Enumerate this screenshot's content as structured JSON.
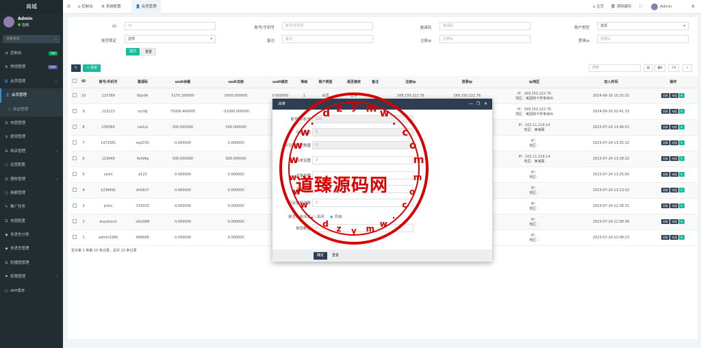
{
  "brand": "商城",
  "user": {
    "name": "Admin",
    "status": "在线"
  },
  "search": {
    "placeholder": "搜索菜单"
  },
  "menu": [
    {
      "label": "控制台",
      "icon": "dashboard-icon",
      "tag": "hot",
      "tag_color": "#00a65a"
    },
    {
      "label": "常规管理",
      "icon": "cogs-icon",
      "tag": "new",
      "tag_color": "#605ca8"
    },
    {
      "label": "会员管理",
      "icon": "user-icon",
      "active": true
    },
    {
      "label": "会员管理",
      "icon": "user-icon",
      "current": true
    },
    {
      "label": "收益管理",
      "icon": "circle-icon",
      "sub": true
    },
    {
      "label": "充值管理",
      "icon": "bars-icon"
    },
    {
      "label": "提现管理",
      "icon": "dollar-icon"
    },
    {
      "label": "商店管理",
      "icon": "bars-icon",
      "caret": true
    },
    {
      "label": "运营配置",
      "icon": "circle-icon"
    },
    {
      "label": "理财管理",
      "icon": "bars-icon",
      "caret": true
    },
    {
      "label": "卷额管理",
      "icon": "circle-icon"
    },
    {
      "label": "推广任务",
      "icon": "wrench-icon"
    },
    {
      "label": "充值配置",
      "icon": "bars-icon"
    },
    {
      "label": "多语言分类",
      "icon": "tag-icon"
    },
    {
      "label": "多语言管理",
      "icon": "tag-icon"
    },
    {
      "label": "轮播图管理",
      "icon": "bars-icon"
    },
    {
      "label": "权限管理",
      "icon": "group-icon",
      "caret": true
    },
    {
      "label": "APP版本",
      "icon": "circle-icon"
    }
  ],
  "topbar": {
    "tabs": [
      "控制台",
      "系统配置",
      "会员管理"
    ],
    "home": "主页",
    "clear": "清除缓存",
    "admin": "Admin"
  },
  "filters": {
    "id_label": "ID",
    "id_ph": "ID",
    "account_label": "账号/手机号",
    "account_ph": "账号/手机号",
    "invite_label": "邀请码",
    "invite_ph": "邀请码",
    "acct_type_label": "账户类型",
    "acct_type_value": "选择",
    "locked_label": "是否锁定",
    "locked_value": "选择",
    "remark_label": "备注",
    "remark_ph": "备注",
    "regip_label": "注册ip",
    "regip_ph": "注册ip",
    "loginip_label": "登录ip",
    "loginip_ph": "登录ip",
    "submit": "提交",
    "reset": "重置"
  },
  "toolbar": {
    "add": "+ 添加",
    "search_ph": "搜索"
  },
  "table": {
    "headers": [
      "ID",
      "账号/手机号",
      "邀请码",
      "usdt余额",
      "usdt冻结",
      "usdt锁定",
      "等级",
      "账户类型",
      "是否锁定",
      "备注",
      "注册ip",
      "登录ip",
      "ip地区",
      "加入时间",
      "操作"
    ],
    "rows": [
      {
        "id": "10",
        "account": "123789",
        "invite": "6tpr9k",
        "balance": "5170.160000",
        "frozen": "5000.000000",
        "locked": "0.000000",
        "level": "1",
        "type": "会员",
        "lock": "正常",
        "remark": "-",
        "regip": "169.150.222.76",
        "loginip": "169.150.222.76",
        "region1": "IP：169.150.222.76",
        "region2": "地区：美国南卡罗来纳州",
        "time": "2024-08-16 10:25:25"
      },
      {
        "id": "9",
        "account": "123123",
        "invite": "sccfdj",
        "balance": "75006.440000",
        "frozen": "-51000.000000",
        "locked": "",
        "level": "",
        "type": "",
        "lock": "",
        "remark": "",
        "regip": "",
        "loginip": "",
        "region1": "IP：169.150.222.76",
        "region2": "地区：美国南卡罗来纳州",
        "time": "2024-08-16 02:41:33"
      },
      {
        "id": "8",
        "account": "258369",
        "invite": "vle1pi",
        "balance": "500.000000",
        "frozen": "500.000000",
        "locked": "",
        "level": "",
        "type": "",
        "lock": "",
        "remark": "",
        "regip": "",
        "loginip": "14",
        "region1": "IP：103.11.219.14",
        "region2": "地区：柬埔寨",
        "time": "2023-07-24 13:46:52"
      },
      {
        "id": "7",
        "account": "1472581",
        "invite": "eq2CfQ",
        "balance": "0.000000",
        "frozen": "0.000000",
        "locked": "",
        "level": "",
        "type": "",
        "lock": "",
        "remark": "",
        "regip": "",
        "loginip": "",
        "region1": "IP：",
        "region2": "地区：",
        "time": "2023-07-24 13:35:32"
      },
      {
        "id": "6",
        "account": "123649",
        "invite": "4xfd4g",
        "balance": "500.000000",
        "frozen": "500.000000",
        "locked": "",
        "level": "",
        "type": "",
        "lock": "",
        "remark": "",
        "regip": "",
        "loginip": "14",
        "region1": "IP：103.11.219.14",
        "region2": "地区：柬埔寨",
        "time": "2023-07-24 13:28:32"
      },
      {
        "id": "5",
        "account": "ceshi",
        "invite": "a123",
        "balance": "0.000000",
        "frozen": "0.000000",
        "locked": "",
        "level": "",
        "type": "",
        "lock": "",
        "remark": "",
        "regip": "",
        "loginip": "",
        "region1": "IP：",
        "region2": "地区：",
        "time": "2023-07-24 13:25:00"
      },
      {
        "id": "4",
        "account": "1236491",
        "invite": "ArOXcT",
        "balance": "0.000000",
        "frozen": "0.000000",
        "locked": "",
        "level": "",
        "type": "",
        "lock": "",
        "remark": "",
        "regip": "",
        "loginip": "",
        "region1": "IP：",
        "region2": "地区：",
        "time": "2023-07-24 13:13:32"
      },
      {
        "id": "3",
        "account": "jmhu",
        "invite": "333333",
        "balance": "0.000000",
        "frozen": "0.000000",
        "locked": "",
        "level": "",
        "type": "",
        "lock": "",
        "remark": "",
        "regip": "",
        "loginip": "",
        "region1": "IP：",
        "region2": "地区：",
        "time": "2023-07-24 12:28:31"
      },
      {
        "id": "2",
        "account": "wuyanzu1",
        "invite": "sGxQ6R",
        "balance": "0.000000",
        "frozen": "0.000000",
        "locked": "",
        "level": "",
        "type": "",
        "lock": "",
        "remark": "",
        "regip": "",
        "loginip": "14",
        "region1": "IP：",
        "region2": "地区：",
        "time": "2023-07-24 12:08:38"
      },
      {
        "id": "1",
        "account": "admin3366",
        "invite": "666666",
        "balance": "0.000000",
        "frozen": "0.000000",
        "locked": "",
        "level": "",
        "type": "",
        "lock": "",
        "remark": "",
        "regip": "",
        "loginip": "",
        "region1": "IP：",
        "region2": "地区：",
        "time": "2023-07-24 12:08:23"
      }
    ],
    "op_deduct": "扣款",
    "op_recharge": "充值",
    "footer": "显示第 1 到第 10 条记录，总共 10 条记录"
  },
  "modal": {
    "title": "派单",
    "fields": [
      {
        "label": "账号/手机号",
        "value": "123",
        "ro": true
      },
      {
        "label": "今日已刷",
        "value": "5",
        "ro": true
      },
      {
        "label": "今日已刷次数量",
        "value": "0",
        "ro": true
      },
      {
        "label": "派单设置",
        "value": "3",
        "ro": false
      },
      {
        "label": "派单金额",
        "value": "",
        "ro": false
      },
      {
        "label": "卡单倍数",
        "value": "",
        "ro": false
      },
      {
        "label": "可派单独次数",
        "value": "0",
        "ro": false
      }
    ],
    "switch_label": "是否开启派单",
    "opt_off": "关闭",
    "opt_on": "开启",
    "last_label": "单倍数量",
    "last_value": "0",
    "ok": "确定",
    "reset": "重置"
  },
  "watermark": {
    "text": "道臻源码网",
    "url1": "w w w . d z y m w . c o m"
  }
}
